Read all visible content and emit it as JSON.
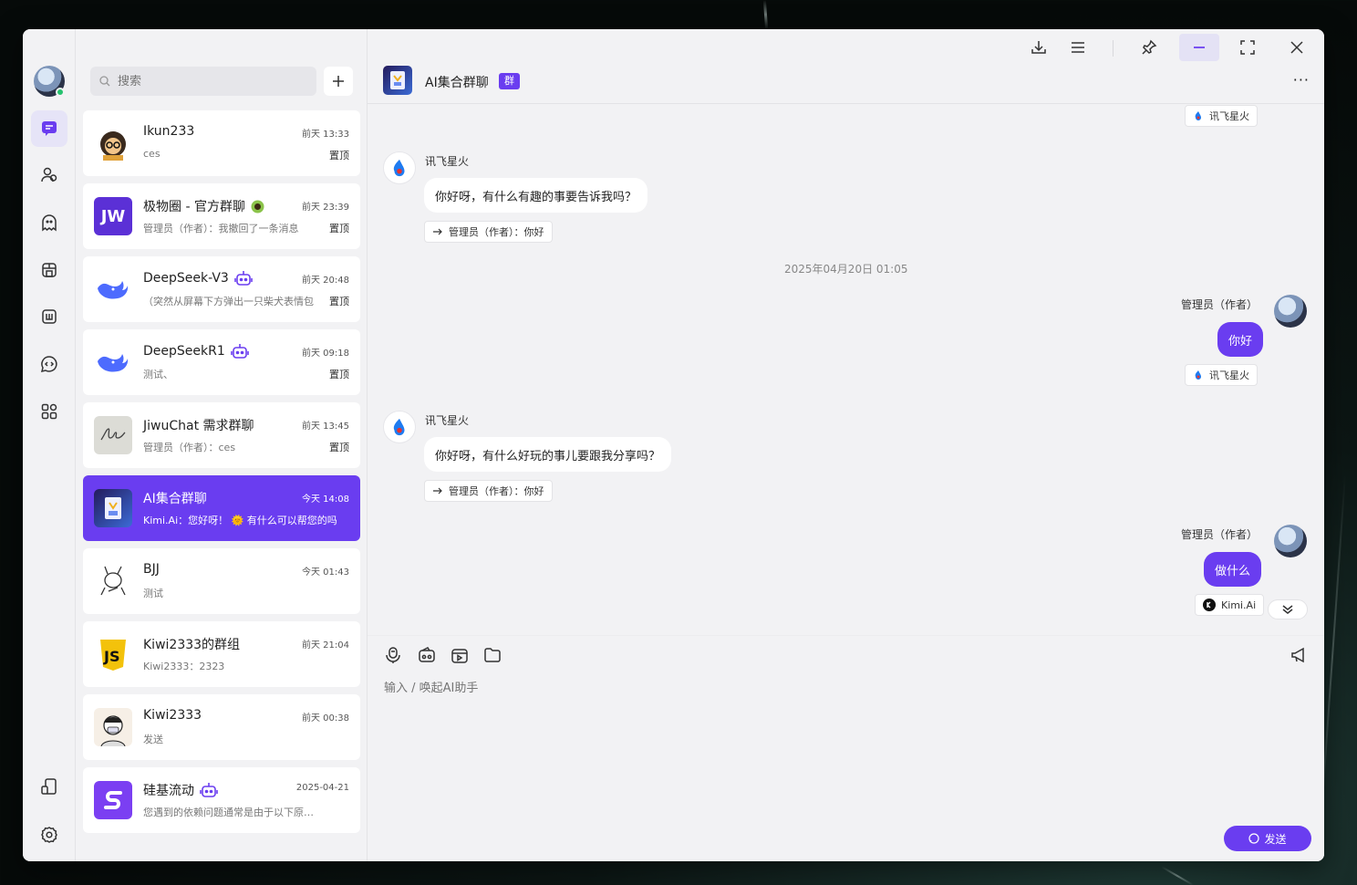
{
  "sidebar": {
    "search_placeholder": "搜索"
  },
  "conversations": [
    {
      "name": "Ikun233",
      "time": "前天 13:33",
      "preview": "ces",
      "pinned": "置顶"
    },
    {
      "name": "极物圈 - 官方群聊",
      "time": "前天 23:39",
      "preview": "管理员（作者）：我撤回了一条消息",
      "pinned": "置顶"
    },
    {
      "name": "DeepSeek-V3",
      "time": "前天 20:48",
      "preview": "（突然从屏幕下方弹出一只柴犬表情包",
      "pinned": "置顶"
    },
    {
      "name": "DeepSeekR1",
      "time": "前天 09:18",
      "preview": "测试、",
      "pinned": "置顶"
    },
    {
      "name": "JiwuChat 需求群聊",
      "time": "前天 13:45",
      "preview": "管理员（作者）：ces",
      "pinned": "置顶"
    },
    {
      "name": "AI集合群聊",
      "time": "今天 14:08",
      "preview": "Kimi.Ai：您好呀！ 🌞 有什么可以帮您的吗",
      "pinned": ""
    },
    {
      "name": "BJJ",
      "time": "今天 01:43",
      "preview": "测试",
      "pinned": ""
    },
    {
      "name": "Kiwi2333的群组",
      "time": "前天 21:04",
      "preview": "Kiwi2333：2323",
      "pinned": ""
    },
    {
      "name": "Kiwi2333",
      "time": "前天 00:38",
      "preview": "发送",
      "pinned": ""
    },
    {
      "name": "硅基流动",
      "time": "2025-04-21",
      "preview": "您遇到的依赖问题通常是由于以下原因之一",
      "pinned": ""
    }
  ],
  "chat": {
    "title": "AI集合群聊",
    "tag": "群",
    "more": "···",
    "top_bot_pill": "讯飞星火",
    "messages": [
      {
        "sender": "讯飞星火",
        "text": "你好呀，有什么有趣的事要告诉我吗？",
        "reply": "管理员（作者）：你好"
      },
      {
        "date": "2025年04月20日 01:05"
      },
      {
        "sender": "管理员（作者）",
        "text": "你好",
        "bot": "讯飞星火"
      },
      {
        "sender": "讯飞星火",
        "text": "你好呀，有什么好玩的事儿要跟我分享吗？",
        "reply": "管理员（作者）：你好"
      },
      {
        "sender": "管理员（作者）",
        "text": "做什么",
        "bot": "Kimi.Ai"
      }
    ]
  },
  "composer": {
    "placeholder": "输入 / 唤起AI助手",
    "send_label": "发送"
  },
  "icons": [
    "chat-icon",
    "friends-icon",
    "ghost-icon",
    "store-icon",
    "book-icon",
    "code-chat-icon",
    "apps-icon",
    "device-icon",
    "settings-icon",
    "download-icon",
    "menu-icon",
    "pin-icon",
    "minimize-icon",
    "maximize-icon",
    "close-icon",
    "mic-icon",
    "wallet-icon",
    "video-icon",
    "folder-icon",
    "megaphone-icon"
  ],
  "colors": {
    "accent": "#6a3df0",
    "online": "#25c26e"
  }
}
